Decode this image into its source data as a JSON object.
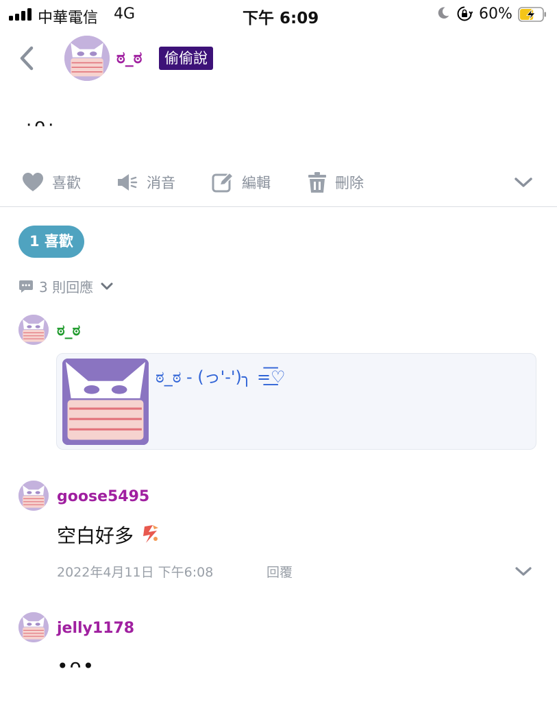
{
  "status_bar": {
    "carrier": "中華電信",
    "network": "4G",
    "time": "下午 6:09",
    "battery_percent": "60%",
    "icons": [
      "signal-icon",
      "moon-icon",
      "rotation-lock-icon",
      "battery-charging-icon"
    ],
    "battery_level": 0.6,
    "battery_color": "#f5c518"
  },
  "post": {
    "author": "ಠ_ಠ",
    "board_badge": "偷偷說",
    "body": "·ᴖ·",
    "actions": [
      {
        "icon": "heart-icon",
        "label": "喜歡"
      },
      {
        "icon": "mute-icon",
        "label": "消音"
      },
      {
        "icon": "edit-icon",
        "label": "編輯"
      },
      {
        "icon": "trash-icon",
        "label": "刪除"
      }
    ]
  },
  "reactions": {
    "likes": "1 喜歡",
    "replies": "3 則回應"
  },
  "comments": [
    {
      "author": "ಠ_ಠ",
      "author_color": "#1f9a2c",
      "quote": {
        "title": "ಠ_ಠ - (っ'-')╮ =͟͟͞͞♡"
      }
    },
    {
      "author": "goose5495",
      "author_color": "#a020a0",
      "text": "空白好多",
      "emoji": "dragon-sticker-icon",
      "date": "2022年4月11日 下午6:08",
      "reply_label": "回覆"
    },
    {
      "author": "jelly1178",
      "author_color": "#a020a0",
      "text": "•ᴖ•"
    }
  ],
  "colors": {
    "badge_bg": "#3d1278",
    "like_pill": "#4fa3c0",
    "author_purple": "#a020a0",
    "quote_text": "#2f63d6",
    "action_gray": "#8a919c"
  }
}
